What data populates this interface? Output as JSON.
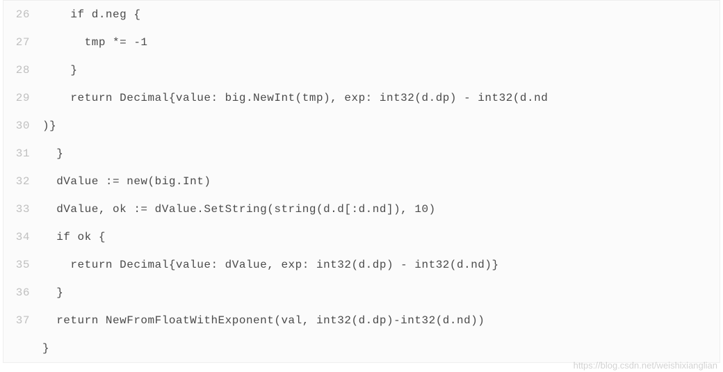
{
  "code": {
    "lines": [
      {
        "num": "26",
        "text": "    if d.neg {"
      },
      {
        "num": "27",
        "text": "      tmp *= -1"
      },
      {
        "num": "28",
        "text": "    }"
      },
      {
        "num": "29",
        "text": "    return Decimal{value: big.NewInt(tmp), exp: int32(d.dp) - int32(d.nd"
      },
      {
        "num": "30",
        "text": ")}"
      },
      {
        "num": "31",
        "text": "  }"
      },
      {
        "num": "32",
        "text": "  dValue := new(big.Int)"
      },
      {
        "num": "33",
        "text": "  dValue, ok := dValue.SetString(string(d.d[:d.nd]), 10)"
      },
      {
        "num": "34",
        "text": "  if ok {"
      },
      {
        "num": "35",
        "text": "    return Decimal{value: dValue, exp: int32(d.dp) - int32(d.nd)}"
      },
      {
        "num": "36",
        "text": "  }"
      },
      {
        "num": "37",
        "text": "  return NewFromFloatWithExponent(val, int32(d.dp)-int32(d.nd))"
      },
      {
        "num": "",
        "text": "}"
      }
    ]
  },
  "watermark": "https://blog.csdn.net/weishixianglian"
}
